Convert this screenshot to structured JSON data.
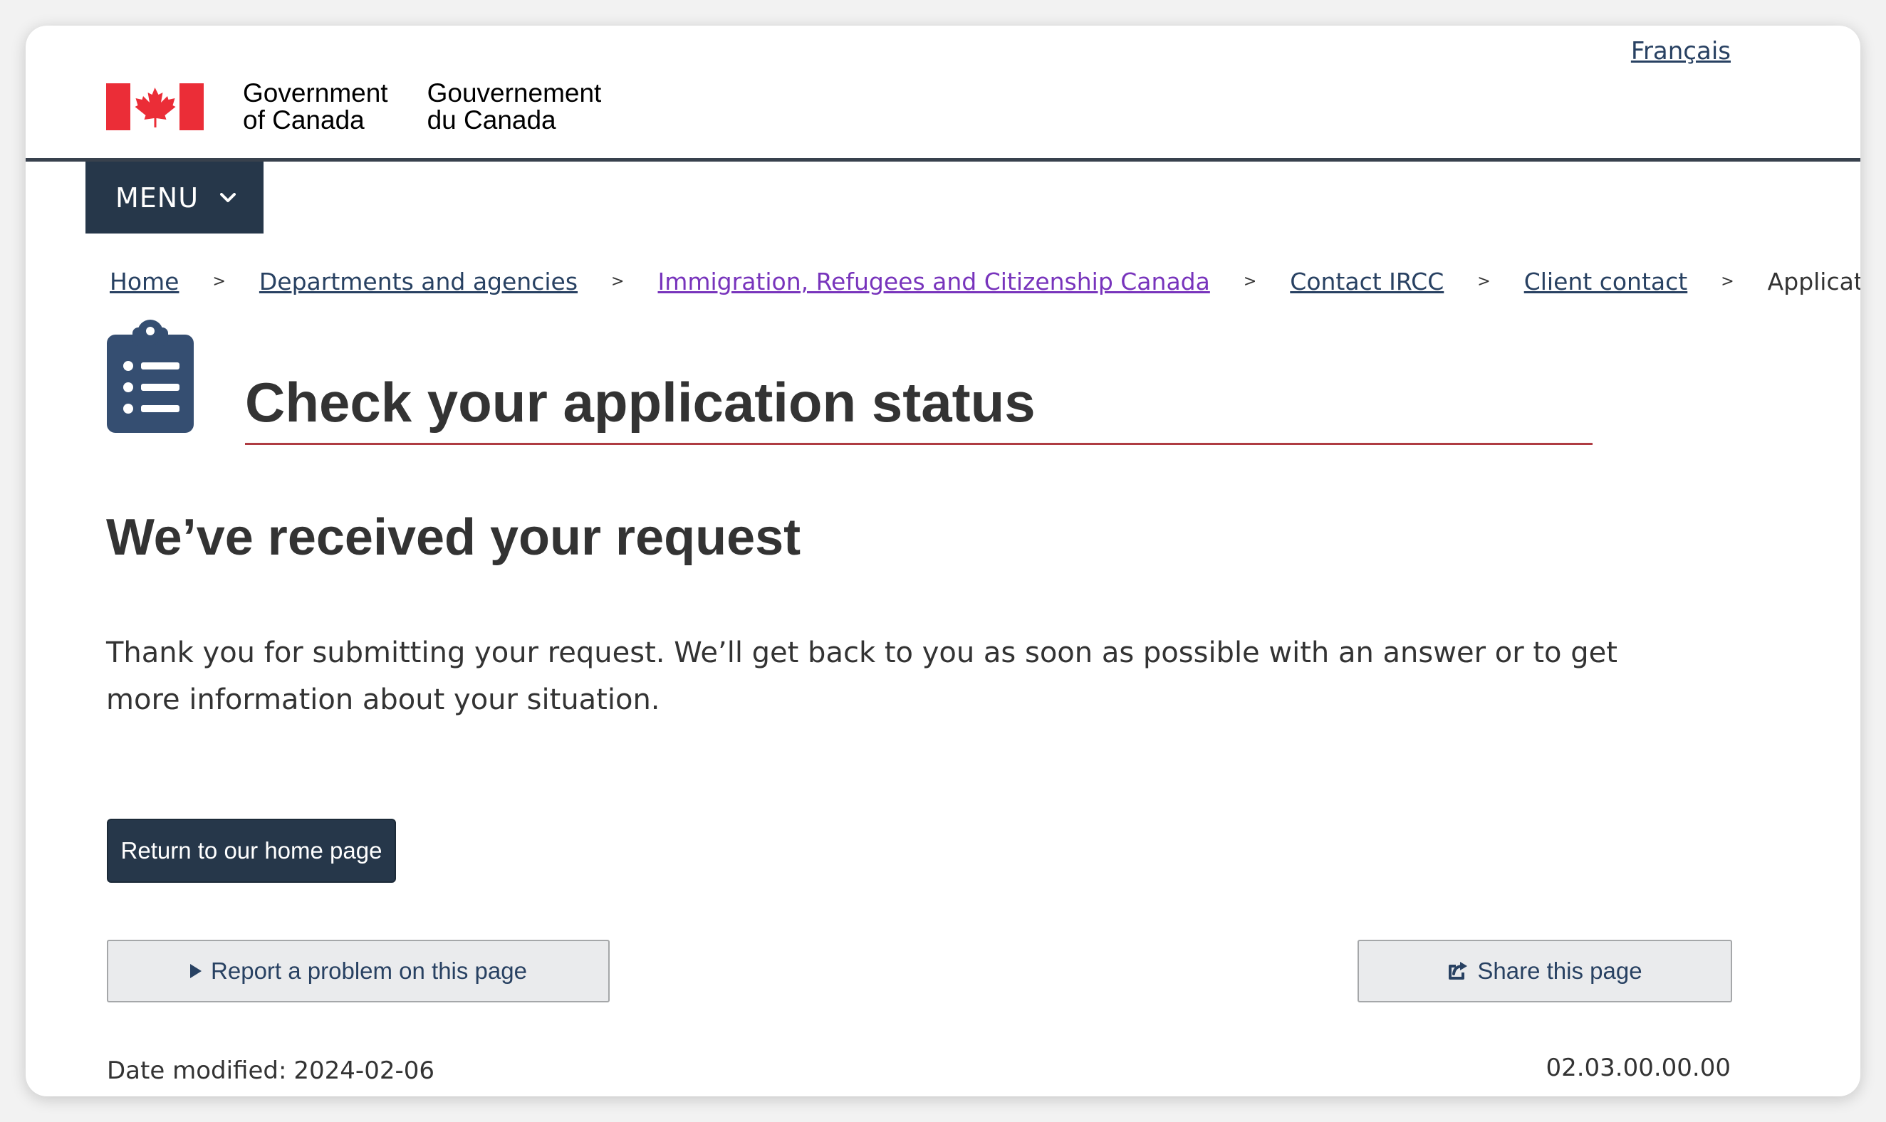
{
  "header": {
    "language_link": "Français",
    "wordmark_en_line1": "Government",
    "wordmark_en_line2": "of Canada",
    "wordmark_fr_line1": "Gouvernement",
    "wordmark_fr_line2": "du Canada"
  },
  "menu": {
    "label": "MENU"
  },
  "breadcrumb": {
    "items": [
      {
        "label": "Home"
      },
      {
        "label": "Departments and agencies"
      },
      {
        "label": "Immigration, Refugees and Citizenship Canada"
      },
      {
        "label": "Contact IRCC"
      },
      {
        "label": "Client contact"
      }
    ],
    "separator": ">",
    "current": "Application"
  },
  "page": {
    "title": "Check your application status",
    "subheading": "We’ve received your request",
    "body": "Thank you for submitting your request. We’ll get back to you as soon as possible with an answer or to get more information about your situation.",
    "primary_button": "Return to our home page",
    "report_button": "Report a problem on this page",
    "share_button": "Share this page"
  },
  "footer": {
    "date_modified_label": "Date modified:",
    "date_modified_value": "2024-02-06",
    "version": "02.03.00.00.00"
  },
  "colors": {
    "navy": "#26374a",
    "link": "#284162",
    "visited_link": "#7834bc",
    "title_rule": "#af3c43",
    "flag_red": "#eb2d37"
  },
  "icons": [
    "maple-leaf-icon",
    "chevron-down-icon",
    "clipboard-list-icon",
    "play-triangle-icon",
    "share-icon"
  ]
}
